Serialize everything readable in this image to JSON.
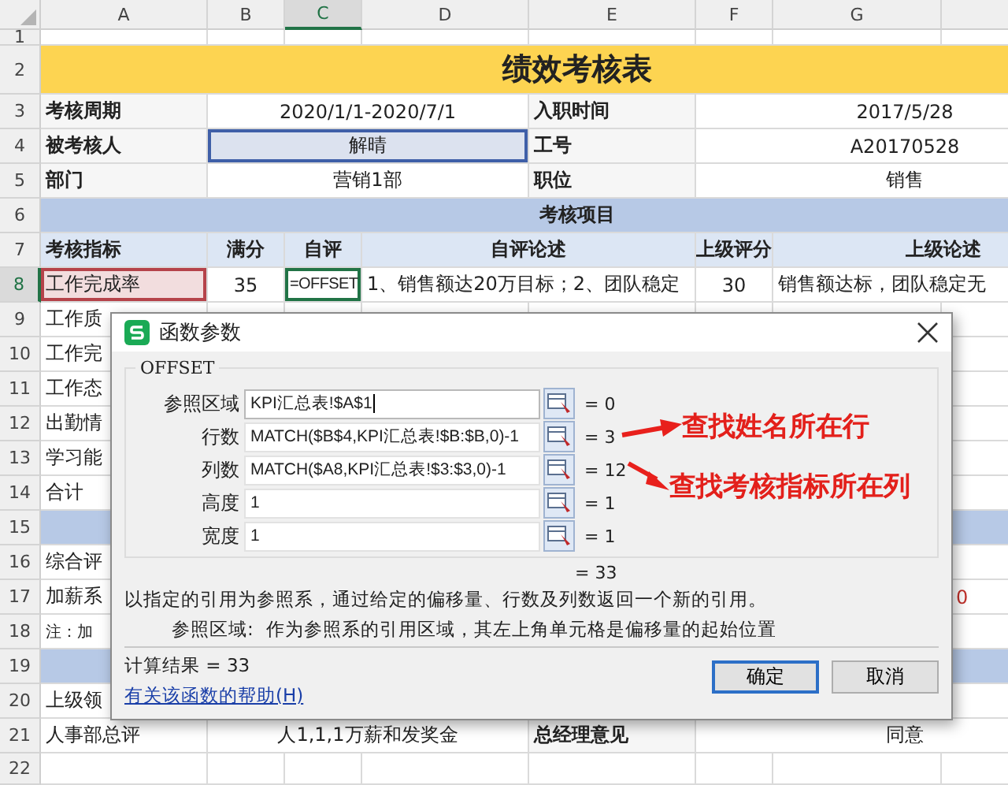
{
  "column_headers": [
    {
      "label": "A",
      "selected": false
    },
    {
      "label": "B",
      "selected": false
    },
    {
      "label": "C",
      "selected": true
    },
    {
      "label": "D",
      "selected": false
    },
    {
      "label": "E",
      "selected": false
    },
    {
      "label": "F",
      "selected": false
    },
    {
      "label": "G",
      "selected": false
    }
  ],
  "row_headers": [
    {
      "label": "1",
      "selected": false
    },
    {
      "label": "2",
      "selected": false
    },
    {
      "label": "3",
      "selected": false
    },
    {
      "label": "4",
      "selected": false
    },
    {
      "label": "5",
      "selected": false
    },
    {
      "label": "6",
      "selected": false
    },
    {
      "label": "7",
      "selected": false
    },
    {
      "label": "8",
      "selected": true
    },
    {
      "label": "9",
      "selected": false
    },
    {
      "label": "10",
      "selected": false
    },
    {
      "label": "11",
      "selected": false
    },
    {
      "label": "12",
      "selected": false
    },
    {
      "label": "13",
      "selected": false
    },
    {
      "label": "14",
      "selected": false
    },
    {
      "label": "15",
      "selected": false
    },
    {
      "label": "16",
      "selected": false
    },
    {
      "label": "17",
      "selected": false
    },
    {
      "label": "18",
      "selected": false
    },
    {
      "label": "19",
      "selected": false
    },
    {
      "label": "20",
      "selected": false
    },
    {
      "label": "21",
      "selected": false
    },
    {
      "label": "22",
      "selected": false
    }
  ],
  "cells": [
    {
      "kind": "title",
      "text": "绩效考核表"
    },
    {
      "kind": "label",
      "text": "考核周期"
    },
    {
      "kind": "value",
      "text": "2020/1/1-2020/7/1"
    },
    {
      "kind": "label",
      "text": "入职时间"
    },
    {
      "kind": "value",
      "text": "2017/5/28"
    },
    {
      "kind": "label",
      "text": "被考核人"
    },
    {
      "kind": "value",
      "text": "解晴",
      "color": "#3f5fa8"
    },
    {
      "kind": "label",
      "text": "工号"
    },
    {
      "kind": "value",
      "text": "A20170528"
    },
    {
      "kind": "label",
      "text": "部门"
    },
    {
      "kind": "value",
      "text": "营销1部"
    },
    {
      "kind": "label",
      "text": "职位"
    },
    {
      "kind": "value",
      "text": "销售"
    },
    {
      "kind": "section",
      "text": "考核项目"
    },
    {
      "kind": "header-left",
      "text": "考核指标"
    },
    {
      "kind": "header",
      "text": "满分"
    },
    {
      "kind": "header",
      "text": "自评"
    },
    {
      "kind": "header",
      "text": "自评论述"
    },
    {
      "kind": "header",
      "text": "上级评分"
    },
    {
      "kind": "header",
      "text": "上级论述"
    },
    {
      "kind": "text",
      "text": "工作完成率",
      "color": "#b5434a"
    },
    {
      "kind": "value",
      "text": "35"
    },
    {
      "kind": "formula",
      "text": "=OFFSET"
    },
    {
      "kind": "text",
      "text": "1、销售额达20万目标；2、团队稳定"
    },
    {
      "kind": "value",
      "text": "30"
    },
    {
      "kind": "text",
      "text": "销售额达标，团队稳定无"
    },
    {
      "kind": "text",
      "text": "工作质"
    },
    {
      "kind": "text",
      "text": "工作完"
    },
    {
      "kind": "text",
      "text": "工作态"
    },
    {
      "kind": "text",
      "text": "出勤情"
    },
    {
      "kind": "text",
      "text": "学习能"
    },
    {
      "kind": "text",
      "text": "合计"
    },
    {
      "kind": "bar"
    },
    {
      "kind": "text",
      "text": "综合评"
    },
    {
      "kind": "text",
      "text": "加薪系"
    },
    {
      "kind": "warning",
      "text": "0"
    },
    {
      "kind": "note",
      "text": "注：加"
    },
    {
      "kind": "bar"
    },
    {
      "kind": "text",
      "text": "上级领"
    },
    {
      "kind": "text",
      "text": "人事部总评"
    },
    {
      "kind": "value",
      "text": "人1,1,1万薪和发奖金"
    },
    {
      "kind": "label",
      "text": "总经理意见"
    },
    {
      "kind": "value",
      "text": "同意"
    }
  ],
  "dialog": {
    "title": "函数参数",
    "function_name": "OFFSET",
    "arguments": [
      {
        "label": "参照区域",
        "value": "KPI汇总表!$A$1",
        "result": "= 0",
        "focused": true
      },
      {
        "label": "行数",
        "value": "MATCH($B$4,KPI汇总表!$B:$B,0)-1",
        "result": "= 3",
        "focused": false
      },
      {
        "label": "列数",
        "value": "MATCH($A8,KPI汇总表!$3:$3,0)-1",
        "result": "= 12",
        "focused": false
      },
      {
        "label": "高度",
        "value": "1",
        "result": "= 1",
        "focused": false
      },
      {
        "label": "宽度",
        "value": "1",
        "result": "= 1",
        "focused": false
      }
    ],
    "formula_result": "= 33",
    "description": "以指定的引用为参照系，通过给定的偏移量、行数及列数返回一个新的引用。",
    "argument_help_label": "参照区域:",
    "argument_help": "作为参照系的引用区域，其左上角单元格是偏移量的起始位置",
    "calc_result": "计算结果 = 33",
    "help_link": "有关该函数的帮助(H)",
    "buttons": [
      {
        "label": "确定",
        "selected": true
      },
      {
        "label": "取消",
        "selected": false
      }
    ]
  },
  "annotations": [
    {
      "text": "查找姓名所在行"
    },
    {
      "text": "查找考核指标所在列"
    }
  ]
}
